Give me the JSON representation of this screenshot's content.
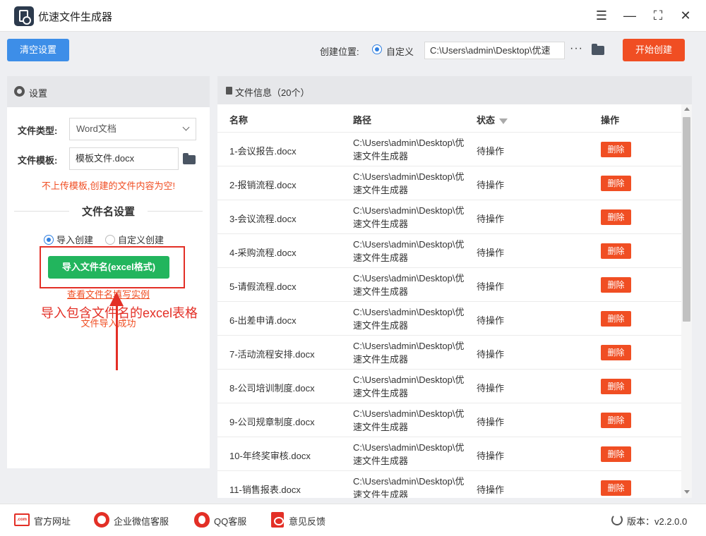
{
  "app": {
    "title": "优速文件生成器"
  },
  "toolbar": {
    "clear_label": "清空设置",
    "location_label": "创建位置:",
    "location_option": "自定义",
    "path_value": "C:\\Users\\admin\\Desktop\\优速",
    "more_label": "···",
    "start_label": "开始创建"
  },
  "settings": {
    "title": "设置",
    "file_type_label": "文件类型:",
    "file_type_value": "Word文档",
    "template_label": "文件模板:",
    "template_value": "模板文件.docx",
    "template_warning": "不上传模板,创建的文件内容为空!",
    "name_section_title": "文件名设置",
    "mode_import": "导入创建",
    "mode_custom": "自定义创建",
    "import_button": "导入文件名(excel格式)",
    "example_link": "查看文件名填写实例",
    "import_status": "文件导入成功",
    "annotation": "导入包含文件名的excel表格"
  },
  "files": {
    "title": "文件信息（20个）",
    "columns": [
      "名称",
      "路径",
      "状态",
      "操作"
    ],
    "delete_label": "删除",
    "rows": [
      {
        "name": "1-会议报告.docx",
        "path": "C:\\Users\\admin\\Desktop\\优速文件生成器",
        "status": "待操作"
      },
      {
        "name": "2-报销流程.docx",
        "path": "C:\\Users\\admin\\Desktop\\优速文件生成器",
        "status": "待操作"
      },
      {
        "name": "3-会议流程.docx",
        "path": "C:\\Users\\admin\\Desktop\\优速文件生成器",
        "status": "待操作"
      },
      {
        "name": "4-采购流程.docx",
        "path": "C:\\Users\\admin\\Desktop\\优速文件生成器",
        "status": "待操作"
      },
      {
        "name": "5-请假流程.docx",
        "path": "C:\\Users\\admin\\Desktop\\优速文件生成器",
        "status": "待操作"
      },
      {
        "name": "6-出差申请.docx",
        "path": "C:\\Users\\admin\\Desktop\\优速文件生成器",
        "status": "待操作"
      },
      {
        "name": "7-活动流程安排.docx",
        "path": "C:\\Users\\admin\\Desktop\\优速文件生成器",
        "status": "待操作"
      },
      {
        "name": "8-公司培训制度.docx",
        "path": "C:\\Users\\admin\\Desktop\\优速文件生成器",
        "status": "待操作"
      },
      {
        "name": "9-公司规章制度.docx",
        "path": "C:\\Users\\admin\\Desktop\\优速文件生成器",
        "status": "待操作"
      },
      {
        "name": "10-年终奖审核.docx",
        "path": "C:\\Users\\admin\\Desktop\\优速文件生成器",
        "status": "待操作"
      },
      {
        "name": "11-销售报表.docx",
        "path": "C:\\Users\\admin\\Desktop\\优速文件生成器",
        "status": "待操作"
      }
    ]
  },
  "footer": {
    "website": "官方网址",
    "web_icon_text": ".com",
    "wechat": "企业微信客服",
    "qq": "QQ客服",
    "feedback": "意见反馈",
    "version": "版本：v2.2.0.0"
  },
  "colors": {
    "accent_blue": "#3d8ee8",
    "accent_red": "#f04e23",
    "accent_green": "#22b55d",
    "annotation_red": "#e32f26"
  }
}
